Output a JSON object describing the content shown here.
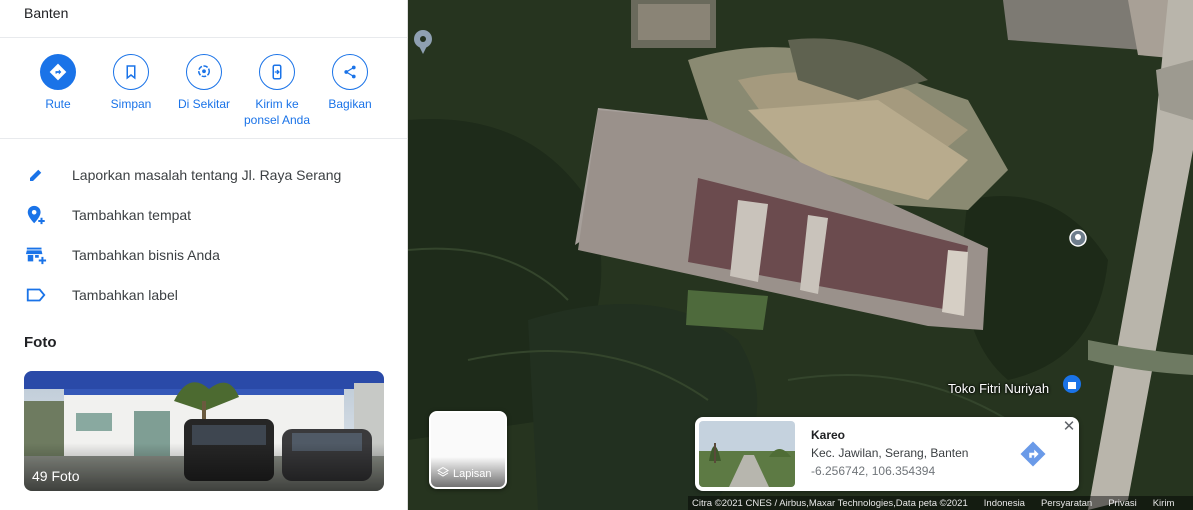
{
  "place": {
    "address_tail": "Banten"
  },
  "actions": [
    {
      "label": "Rute",
      "icon": "directions-icon"
    },
    {
      "label": "Simpan",
      "icon": "bookmark-icon"
    },
    {
      "label": "Di Sekitar",
      "icon": "nearby-icon"
    },
    {
      "label": "Kirim ke ponsel Anda",
      "icon": "send-to-phone-icon"
    },
    {
      "label": "Bagikan",
      "icon": "share-icon"
    }
  ],
  "menu": [
    {
      "label": "Laporkan masalah tentang Jl. Raya Serang",
      "icon": "pencil-icon"
    },
    {
      "label": "Tambahkan tempat",
      "icon": "add-place-icon"
    },
    {
      "label": "Tambahkan bisnis Anda",
      "icon": "add-business-icon"
    },
    {
      "label": "Tambahkan label",
      "icon": "label-icon"
    }
  ],
  "photos": {
    "title": "Foto",
    "count_label": "49 Foto"
  },
  "map": {
    "layer_button": "Lapisan",
    "poi_label": "Toko Fitri Nuriyah",
    "info_card": {
      "name": "Kareo",
      "subtitle": "Kec. Jawilan, Serang, Banten",
      "coords": "-6.256742, 106.354394"
    },
    "footer": {
      "attribution": "Citra ©2021 CNES / Airbus,Maxar Technologies,Data peta ©2021",
      "region": "Indonesia",
      "terms": "Persyaratan",
      "privacy": "Privasi",
      "send": "Kirim"
    }
  },
  "colors": {
    "accent": "#1a73e8",
    "text": "#3c4043"
  }
}
